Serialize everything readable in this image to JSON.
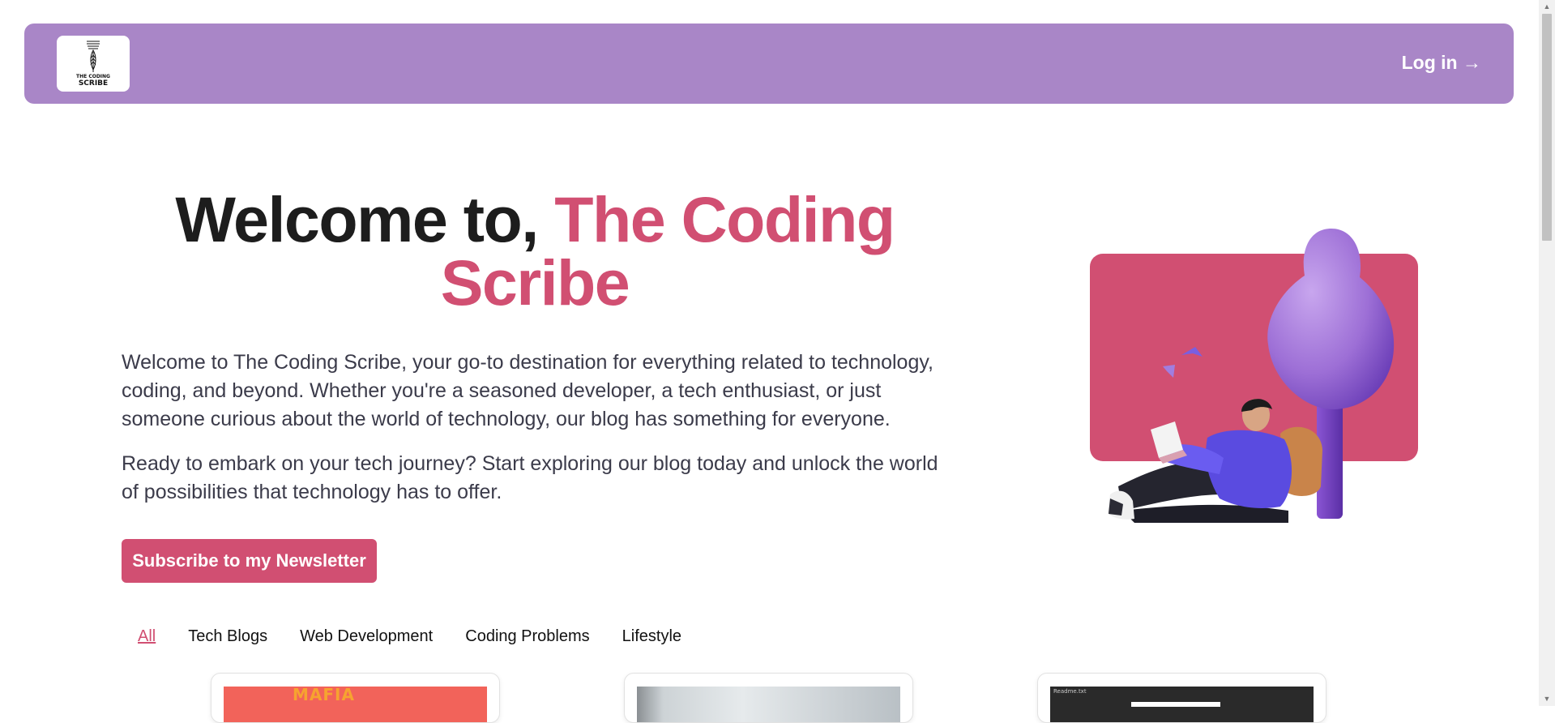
{
  "header": {
    "logo_line1": "THE CODING",
    "logo_line2": "SCRIBE",
    "login_label": "Log in →"
  },
  "hero": {
    "title_plain": "Welcome to, ",
    "title_accent": "The Coding Scribe",
    "paragraph1": "Welcome to The Coding Scribe, your go-to destination for everything related to technology, coding, and beyond. Whether you're a seasoned developer, a tech enthusiast, or just someone curious about the world of technology, our blog has something for everyone.",
    "paragraph2": "Ready to embark on your tech journey? Start exploring our blog today and unlock the world of possibilities that technology has to offer.",
    "subscribe_label": "Subscribe to my Newsletter"
  },
  "categories": [
    {
      "label": "All",
      "active": true
    },
    {
      "label": "Tech Blogs",
      "active": false
    },
    {
      "label": "Web Development",
      "active": false
    },
    {
      "label": "Coding Problems",
      "active": false
    },
    {
      "label": "Lifestyle",
      "active": false
    }
  ],
  "cards": {
    "card1_tag": "MAFIA",
    "card3_caption": "Readme.txt"
  },
  "colors": {
    "header_bg": "#a986c7",
    "accent": "#d14f72",
    "tree": "#9d6fd6",
    "hoodie": "#5a4be0"
  },
  "icons": {
    "logo": "quill-pen-icon",
    "illustration": "person-reading-under-tree"
  }
}
